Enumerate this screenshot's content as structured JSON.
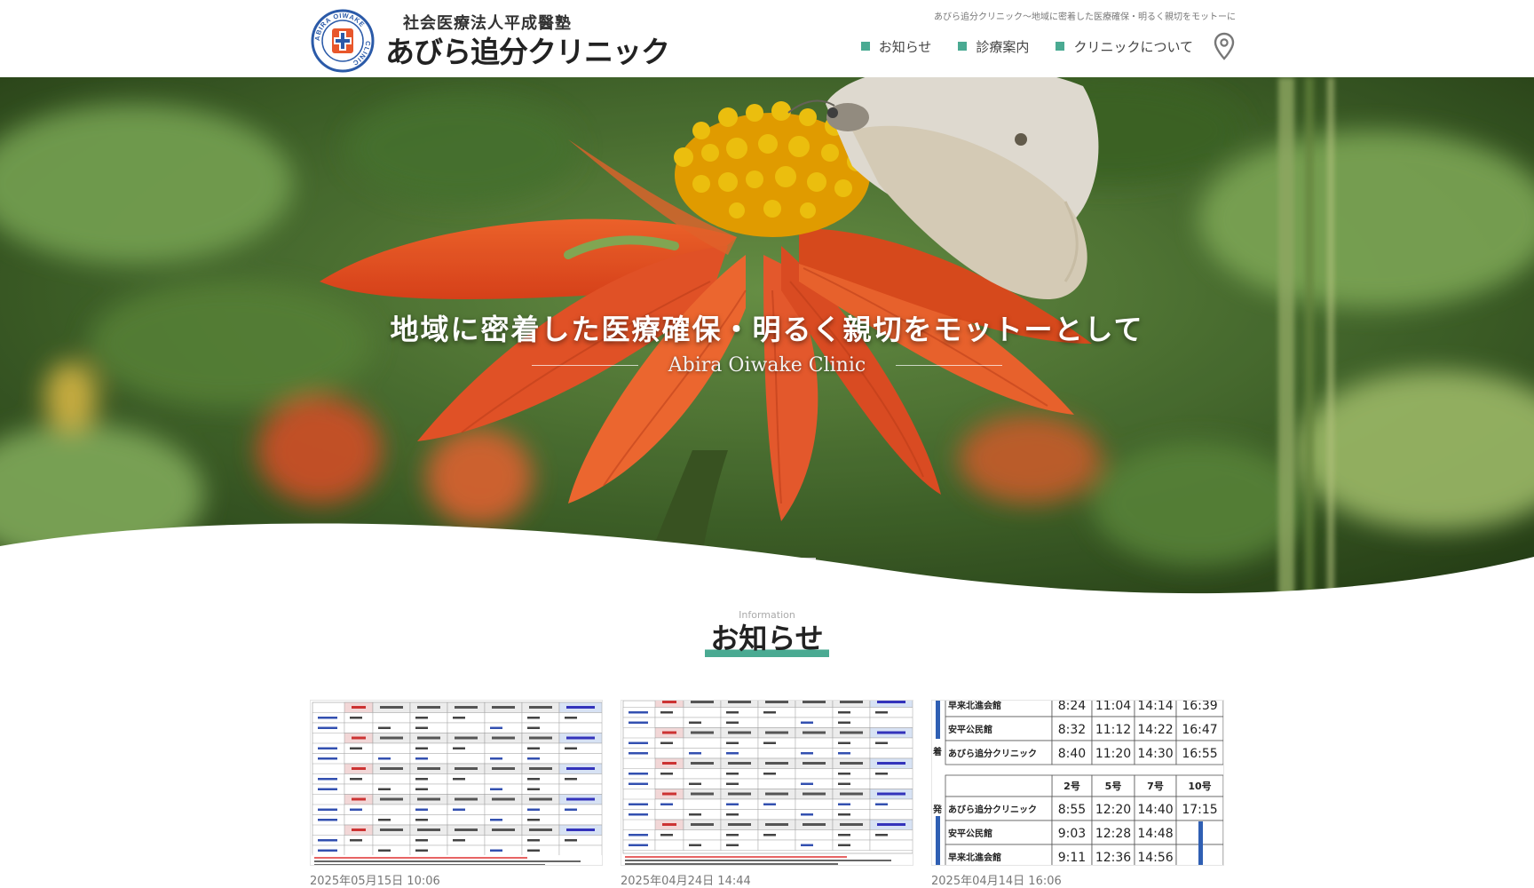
{
  "header": {
    "logo_title": "社会医療法人平成醫塾",
    "logo_name": "あびら追分クリニック",
    "logo_seal_text": "ABIRA OIWAKE CLINIC",
    "tagline": "あびら追分クリニック～地域に密着した医療確保・明るく親切をモットーに",
    "nav": [
      {
        "label": "お知らせ"
      },
      {
        "label": "診療案内"
      },
      {
        "label": "クリニックについて"
      }
    ],
    "pin_icon": "map-pin-icon"
  },
  "hero": {
    "title": "地域に密着した医療確保・明るく親切をモットーとして",
    "subtitle": "Abira Oiwake Clinic",
    "slide_count": 3,
    "active_slide": 1
  },
  "info": {
    "eyebrow": "Information",
    "title": "お知らせ",
    "cards": [
      {
        "date": "2025年05月15日 10:06"
      },
      {
        "date": "2025年04月24日 14:44"
      },
      {
        "date": "2025年04月14日 16:06"
      }
    ],
    "bus_timetable": {
      "rows_top": [
        {
          "stop": "早来北進会館",
          "times": [
            "8:24",
            "11:04",
            "14:14",
            "16:39"
          ]
        },
        {
          "stop": "安平公民館",
          "times": [
            "8:32",
            "11:12",
            "14:22",
            "16:47"
          ]
        },
        {
          "stop": "あびら追分クリニック",
          "times": [
            "8:40",
            "11:20",
            "14:30",
            "16:55"
          ]
        }
      ],
      "headers": [
        "2号",
        "5号",
        "7号",
        "10号"
      ],
      "rows_bottom": [
        {
          "stop": "あびら追分クリニック",
          "times": [
            "8:55",
            "12:20",
            "14:40",
            "17:15"
          ]
        },
        {
          "stop": "安平公民館",
          "times": [
            "9:03",
            "12:28",
            "14:48",
            ""
          ]
        },
        {
          "stop": "早来北進会館",
          "times": [
            "9:11",
            "12:36",
            "14:56",
            ""
          ]
        }
      ],
      "side_label_arrive": "着",
      "side_label_depart": "発"
    }
  },
  "colors": {
    "accent": "#4aaa92",
    "dot_inactive": "#cfcfcf"
  }
}
